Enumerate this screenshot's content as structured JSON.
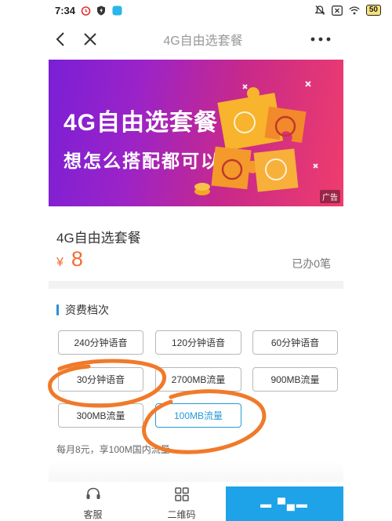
{
  "status": {
    "time": "7:34",
    "battery": "50",
    "icons": [
      "alarm-icon",
      "shield-icon",
      "app-icon",
      "mute-icon",
      "close-box-icon",
      "wifi-icon"
    ]
  },
  "nav": {
    "title": "4G自由选套餐",
    "icons": [
      "back-icon",
      "close-icon",
      "more-icon"
    ]
  },
  "banner": {
    "title": "4G自由选套餐",
    "subtitle": "想怎么搭配都可以",
    "ad_tag": "广告"
  },
  "plan": {
    "name": "4G自由选套餐",
    "currency": "¥",
    "price": "8",
    "sold": "已办0笔"
  },
  "tariff": {
    "section_title": "资费档次",
    "options": [
      {
        "label": "240分钟语音",
        "selected": false
      },
      {
        "label": "120分钟语音",
        "selected": false
      },
      {
        "label": "60分钟语音",
        "selected": false
      },
      {
        "label": "30分钟语音",
        "selected": false
      },
      {
        "label": "2700MB流量",
        "selected": false
      },
      {
        "label": "900MB流量",
        "selected": false
      },
      {
        "label": "300MB流量",
        "selected": false
      },
      {
        "label": "100MB流量",
        "selected": true
      }
    ],
    "description": "每月8元，享100M国内流量"
  },
  "bottom": {
    "service_label": "客服",
    "qr_label": "二维码",
    "cta_label": "▬ ▀▄▬"
  },
  "colors": {
    "accent": "#2a9ad6",
    "price": "#f26d35",
    "cta": "#1fa3e8",
    "annotation": "#f07a2a"
  }
}
